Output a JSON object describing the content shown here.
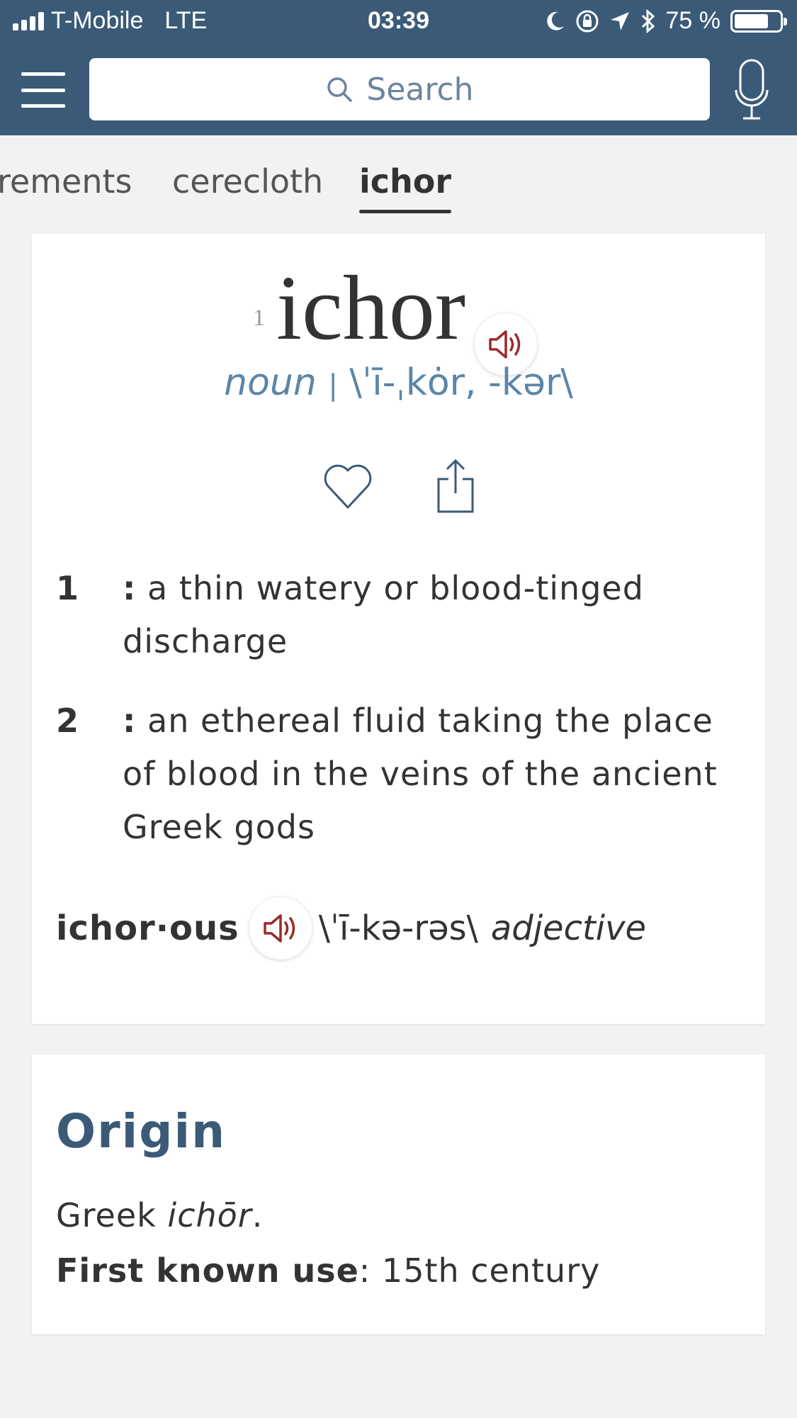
{
  "status_bar": {
    "carrier": "T-Mobile",
    "network": "LTE",
    "time": "03:39",
    "battery": "75 %"
  },
  "header": {
    "search_placeholder": "Search"
  },
  "tabs": [
    {
      "label": "rements",
      "active": false
    },
    {
      "label": "cerecloth",
      "active": false
    },
    {
      "label": "ichor",
      "active": true
    }
  ],
  "entry": {
    "homograph": "1",
    "headword": "ichor",
    "part_of_speech": "noun",
    "separator": "|",
    "pronunciation": "\\ˈī-ˌkȯr, -kər\\",
    "senses": [
      {
        "number": "1",
        "colon": ":",
        "text": "a thin watery or blood-tinged discharge"
      },
      {
        "number": "2",
        "colon": ":",
        "text": "an ethereal fluid taking the place of blood in the veins of the ancient Greek gods"
      }
    ],
    "run_on": {
      "word": "ichor·ous",
      "pronunciation": "\\ˈī-kə-rəs\\",
      "part_of_speech": "adjective"
    }
  },
  "origin": {
    "title": "Origin",
    "language": "Greek",
    "etymon": "ichōr",
    "period": ".",
    "first_use_label": "First known use",
    "first_use_sep": ":",
    "first_use_value": "15th century"
  },
  "colors": {
    "header_bg": "#3a5a78",
    "accent_red": "#9b2a2a",
    "pron_blue": "#5a86a8"
  }
}
